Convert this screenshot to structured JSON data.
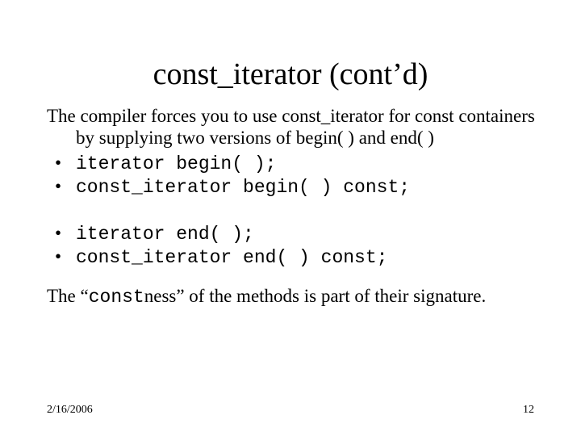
{
  "title": "const_iterator (cont’d)",
  "body": {
    "para1": "The compiler forces you to use const_iterator for const containers by supplying two versions of begin( ) and end( )",
    "bullets1": [
      "iterator begin( );",
      "const_iterator begin( ) const;"
    ],
    "bullets2": [
      "iterator end( );",
      "const_iterator end( ) const;"
    ],
    "para2_pre": "The “",
    "para2_code": "const",
    "para2_post": "ness” of the methods is part of their signature."
  },
  "footer": {
    "date": "2/16/2006",
    "page": "12"
  }
}
